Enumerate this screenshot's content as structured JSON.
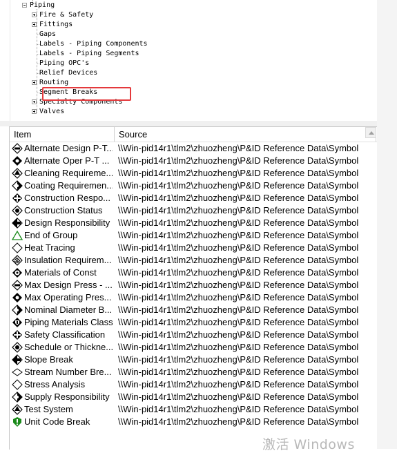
{
  "tree": {
    "root": "Piping",
    "children": [
      {
        "label": "Fire & Safety",
        "expandable": true
      },
      {
        "label": "Fittings",
        "expandable": true
      },
      {
        "label": "Gaps",
        "expandable": false
      },
      {
        "label": "Labels - Piping Components",
        "expandable": false
      },
      {
        "label": "Labels - Piping Segments",
        "expandable": false
      },
      {
        "label": "Piping OPC's",
        "expandable": false
      },
      {
        "label": "Relief Devices",
        "expandable": false
      },
      {
        "label": "Routing",
        "expandable": true
      },
      {
        "label": "Segment Breaks",
        "expandable": false
      },
      {
        "label": "Specialty Components",
        "expandable": true
      },
      {
        "label": "Valves",
        "expandable": true
      }
    ]
  },
  "list": {
    "columns": {
      "item": "Item",
      "source": "Source"
    },
    "rows": [
      {
        "item": "Alternate Design P-T...",
        "source": "\\\\Win-pid14r1\\tlm2\\zhuozheng\\P&ID Reference Data\\Symbol",
        "icon": "diamond-bar-icon"
      },
      {
        "item": "Alternate Oper P-T ...",
        "source": "\\\\Win-pid14r1\\tlm2\\zhuozheng\\P&ID Reference Data\\Symbol",
        "icon": "diamond-black-icon"
      },
      {
        "item": "Cleaning Requireme...",
        "source": "\\\\Win-pid14r1\\tlm2\\zhuozheng\\P&ID Reference Data\\Symbol",
        "icon": "diamond-tri-icon"
      },
      {
        "item": "Coating Requiremen...",
        "source": "\\\\Win-pid14r1\\tlm2\\zhuozheng\\P&ID Reference Data\\Symbol",
        "icon": "diamond-half-icon"
      },
      {
        "item": "Construction Respo...",
        "source": "\\\\Win-pid14r1\\tlm2\\zhuozheng\\P&ID Reference Data\\Symbol",
        "icon": "diamond-cross-icon"
      },
      {
        "item": "Construction Status",
        "source": "\\\\Win-pid14r1\\tlm2\\zhuozheng\\P&ID Reference Data\\Symbol",
        "icon": "diamond-dot-icon"
      },
      {
        "item": "Design Responsibility",
        "source": "\\\\Win-pid14r1\\tlm2\\zhuozheng\\P&ID Reference Data\\Symbol",
        "icon": "diamond-split-icon"
      },
      {
        "item": "End of Group",
        "source": "\\\\Win-pid14r1\\tlm2\\zhuozheng\\P&ID Reference Data\\Symbol",
        "icon": "triangle-green-icon"
      },
      {
        "item": "Heat Tracing",
        "source": "\\\\Win-pid14r1\\tlm2\\zhuozheng\\P&ID Reference Data\\Symbol",
        "icon": "diamond-outline-icon"
      },
      {
        "item": "Insulation Requirem...",
        "source": "\\\\Win-pid14r1\\tlm2\\zhuozheng\\P&ID Reference Data\\Symbol",
        "icon": "diamond-hatch-icon"
      },
      {
        "item": "Materials of Const",
        "source": "\\\\Win-pid14r1\\tlm2\\zhuozheng\\P&ID Reference Data\\Symbol",
        "icon": "diamond-circle-icon"
      },
      {
        "item": "Max Design Press - ...",
        "source": "\\\\Win-pid14r1\\tlm2\\zhuozheng\\P&ID Reference Data\\Symbol",
        "icon": "diamond-bar-icon"
      },
      {
        "item": "Max Operating Pres...",
        "source": "\\\\Win-pid14r1\\tlm2\\zhuozheng\\P&ID Reference Data\\Symbol",
        "icon": "diamond-black-icon"
      },
      {
        "item": "Nominal Diameter B...",
        "source": "\\\\Win-pid14r1\\tlm2\\zhuozheng\\P&ID Reference Data\\Symbol",
        "icon": "diamond-half-icon"
      },
      {
        "item": "Piping Materials Class",
        "source": "\\\\Win-pid14r1\\tlm2\\zhuozheng\\P&ID Reference Data\\Symbol",
        "icon": "diamond-shield-icon"
      },
      {
        "item": "Safety Classification",
        "source": "\\\\Win-pid14r1\\tlm2\\zhuozheng\\P&ID Reference Data\\Symbol",
        "icon": "diamond-cross-icon"
      },
      {
        "item": "Schedule or Thickne...",
        "source": "\\\\Win-pid14r1\\tlm2\\zhuozheng\\P&ID Reference Data\\Symbol",
        "icon": "diamond-dot-icon"
      },
      {
        "item": "Slope Break",
        "source": "\\\\Win-pid14r1\\tlm2\\zhuozheng\\P&ID Reference Data\\Symbol",
        "icon": "diamond-split-icon"
      },
      {
        "item": "Stream Number Bre...",
        "source": "\\\\Win-pid14r1\\tlm2\\zhuozheng\\P&ID Reference Data\\Symbol",
        "icon": "diamond-flat-icon"
      },
      {
        "item": "Stress Analysis",
        "source": "\\\\Win-pid14r1\\tlm2\\zhuozheng\\P&ID Reference Data\\Symbol",
        "icon": "diamond-outline-icon"
      },
      {
        "item": "Supply Responsibility",
        "source": "\\\\Win-pid14r1\\tlm2\\zhuozheng\\P&ID Reference Data\\Symbol",
        "icon": "diamond-half-icon"
      },
      {
        "item": "Test System",
        "source": "\\\\Win-pid14r1\\tlm2\\zhuozheng\\P&ID Reference Data\\Symbol",
        "icon": "diamond-tri-icon"
      },
      {
        "item": "Unit Code Break",
        "source": "\\\\Win-pid14r1\\tlm2\\zhuozheng\\P&ID Reference Data\\Symbol",
        "icon": "shield-green-icon"
      }
    ]
  },
  "watermark": "激活 Windows",
  "colors": {
    "highlight": "#e4393c",
    "symbol_green": "#1a8a1a"
  }
}
